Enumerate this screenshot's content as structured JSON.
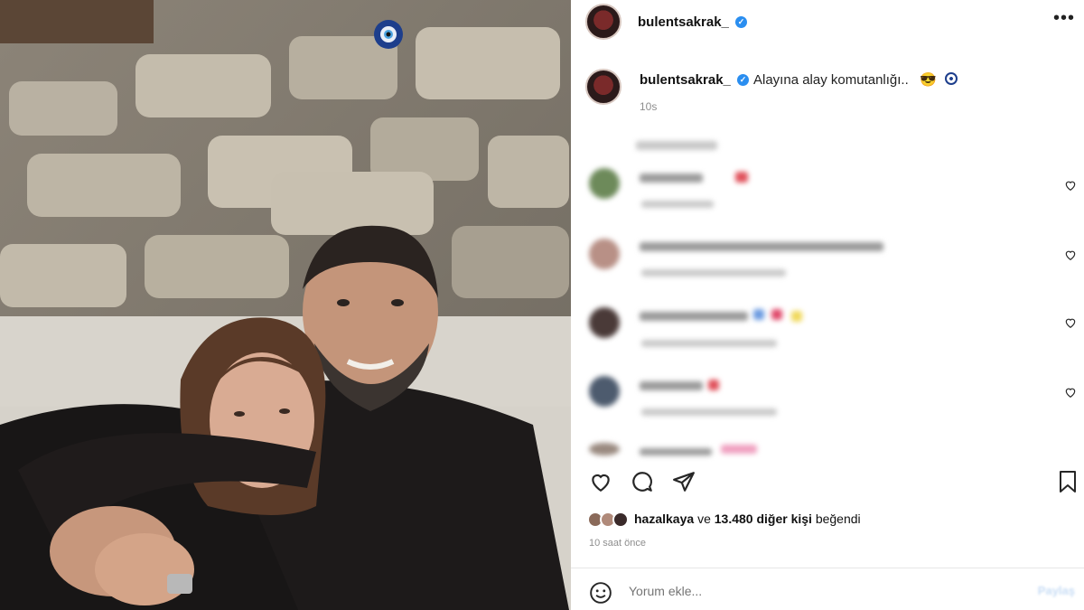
{
  "post": {
    "username": "bulentsakrak_",
    "caption_user": "bulentsakrak_",
    "caption_text": "Alayına alay komutanlığı..",
    "caption_emoji": "😎",
    "caption_time": "10s",
    "more_icon": "more-horizontal-icon"
  },
  "likes": {
    "liker": "hazalkaya",
    "connector": "ve",
    "count_text": "13.480 diğer kişi",
    "suffix": "beğendi",
    "time": "10 saat önce"
  },
  "comment_box": {
    "placeholder": "Yorum ekle...",
    "post_label": "Paylaş"
  },
  "icons": {
    "like": "heart-icon",
    "comment": "comment-icon",
    "share": "send-icon",
    "save": "bookmark-icon",
    "emoji": "smile-icon"
  },
  "colors": {
    "verified": "#2a8ef0",
    "text": "#111111",
    "muted": "#8e8e8e"
  }
}
